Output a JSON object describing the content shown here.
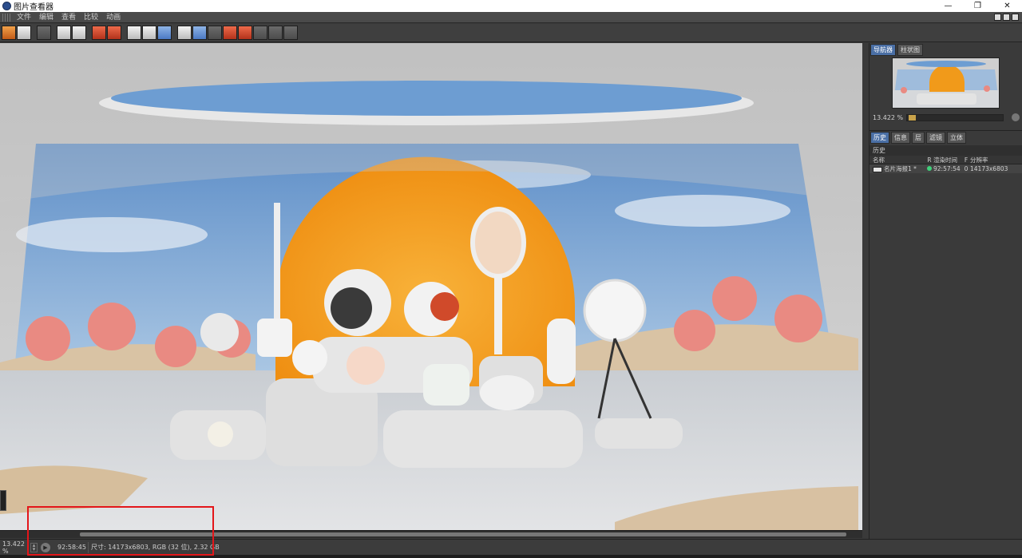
{
  "window": {
    "title": "图片查看器",
    "controls": [
      "—",
      "❐",
      "✕"
    ]
  },
  "menu": [
    "文件",
    "编辑",
    "查看",
    "比较",
    "动画"
  ],
  "navigator": {
    "tabs": [
      "导航器",
      "柱状图"
    ],
    "zoom": "13.422 %"
  },
  "panel_tabs": [
    "历史",
    "信息",
    "层",
    "滤镜",
    "立体"
  ],
  "history": {
    "title": "历史",
    "columns": {
      "name": "名称",
      "r": "R",
      "render_time": "渲染时间",
      "f": "F",
      "resolution": "分辨率"
    },
    "rows": [
      {
        "name": "名片海报1 *",
        "render_time": "92:57:54",
        "f": "0",
        "resolution": "14173x6803"
      }
    ]
  },
  "status": {
    "zoom": "13.422 %",
    "time": "92:58:45",
    "info": "尺寸: 14173x6803, RGB (32 位), 2.32 GB"
  },
  "colors": {
    "accent_tab": "#4a6fa5",
    "highlight_box": "#e3161a",
    "sun_orange": "#f5a020"
  }
}
